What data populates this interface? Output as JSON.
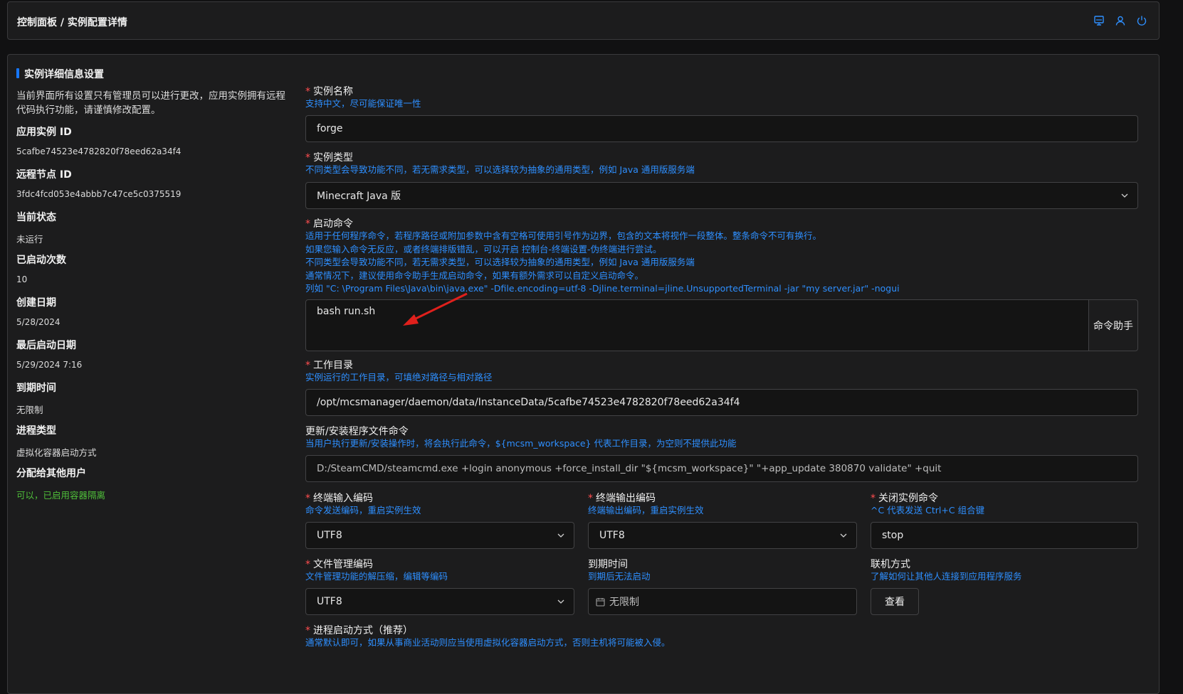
{
  "header": {
    "breadcrumb": "控制面板 / 实例配置详情",
    "icons": [
      "monitor-icon",
      "user-icon",
      "power-icon"
    ]
  },
  "panel": {
    "title": "实例详细信息设置"
  },
  "info": {
    "intro": "当前界面所有设置只有管理员可以进行更改，应用实例拥有远程代码执行功能，请谨慎修改配置。",
    "instance_id_label": "应用实例 ID",
    "instance_id": "5cafbe74523e4782820f78eed62a34f4",
    "node_id_label": "远程节点 ID",
    "node_id": "3fdc4fcd053e4abbb7c47ce5c0375519",
    "status_label": "当前状态",
    "status": "未运行",
    "start_count_label": "已启动次数",
    "start_count": "10",
    "created_label": "创建日期",
    "created": "5/28/2024",
    "last_start_label": "最后启动日期",
    "last_start": "5/29/2024 7:16",
    "expire_label": "到期时间",
    "expire": "无限制",
    "process_type_label": "进程类型",
    "process_type": "虚拟化容器启动方式",
    "assign_label": "分配给其他用户",
    "assign": "可以，已启用容器隔离"
  },
  "form": {
    "required_mark": "*",
    "name": {
      "label": "实例名称",
      "desc": "支持中文，尽可能保证唯一性",
      "value": "forge"
    },
    "type": {
      "label": "实例类型",
      "desc": "不同类型会导致功能不同，若无需求类型，可以选择较为抽象的通用类型，例如 Java 通用版服务端",
      "value": "Minecraft Java 版"
    },
    "start_cmd": {
      "label": "启动命令",
      "desc1": "适用于任何程序命令，若程序路径或附加参数中含有空格可使用引号作为边界，包含的文本将视作一段整体。整条命令不可有换行。",
      "desc2": "如果您输入命令无反应，或者终端排版错乱，可以开启 控制台-终端设置-伪终端进行尝试。",
      "desc3": "不同类型会导致功能不同，若无需求类型，可以选择较为抽象的通用类型，例如 Java 通用版服务端",
      "desc4": "通常情况下，建议使用命令助手生成启动命令，如果有额外需求可以自定义启动命令。",
      "desc5": "列如 \"C: \\Program Files\\Java\\bin\\java.exe\" -Dfile.encoding=utf-8 -Djline.terminal=jline.UnsupportedTerminal -jar \"my server.jar\" -nogui",
      "value": "bash run.sh",
      "helper_button": "命令助手"
    },
    "workdir": {
      "label": "工作目录",
      "desc": "实例运行的工作目录，可填绝对路径与相对路径",
      "value": "/opt/mcsmanager/daemon/data/InstanceData/5cafbe74523e4782820f78eed62a34f4"
    },
    "update_cmd": {
      "label": "更新/安装程序文件命令",
      "desc": "当用户执行更新/安装操作时，将会执行此命令，${mcsm_workspace} 代表工作目录，为空则不提供此功能",
      "value": "D:/SteamCMD/steamcmd.exe +login anonymous +force_install_dir \"${mcsm_workspace}\" \"+app_update 380870 validate\" +quit"
    },
    "input_encoding": {
      "label": "终端输入编码",
      "desc": "命令发送编码，重启实例生效",
      "value": "UTF8"
    },
    "output_encoding": {
      "label": "终端输出编码",
      "desc": "终端输出编码，重启实例生效",
      "value": "UTF8"
    },
    "stop_cmd": {
      "label": "关闭实例命令",
      "desc": "^C 代表发送 Ctrl+C 组合键",
      "value": "stop"
    },
    "file_encoding": {
      "label": "文件管理编码",
      "desc": "文件管理功能的解压缩，编辑等编码",
      "value": "UTF8"
    },
    "expire_time": {
      "label": "到期时间",
      "desc": "到期后无法启动",
      "placeholder": "无限制"
    },
    "connect": {
      "label": "联机方式",
      "desc": "了解如何让其他人连接到应用程序服务",
      "button": "查看"
    },
    "process_mode": {
      "label": "进程启动方式（推荐）",
      "desc": "通常默认即可，如果从事商业活动则应当使用虚拟化容器启动方式，否则主机将可能被入侵。"
    }
  },
  "colors": {
    "accent": "#1677ff",
    "required": "#ff4d4f",
    "desc_blue": "#2e8fff",
    "success": "#4fbf3a",
    "annotation_arrow": "#e0201c"
  }
}
